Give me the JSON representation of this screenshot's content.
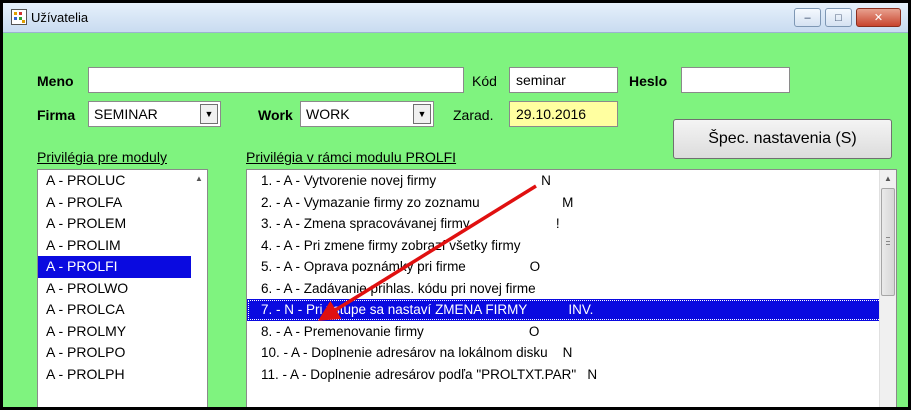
{
  "window": {
    "title": "Užívatelia",
    "minimize_glyph": "–",
    "maximize_glyph": "□",
    "close_glyph": "✕"
  },
  "form": {
    "meno_label": "Meno",
    "meno_value": "",
    "kod_label": "Kód",
    "kod_value": "seminar",
    "heslo_label": "Heslo",
    "heslo_value": "",
    "firma_label": "Firma",
    "firma_value": "SEMINAR",
    "work_label": "Work",
    "work_value": "WORK",
    "zarad_label": "Zarad.",
    "zarad_value": "29.10.2016",
    "spec_button_label": "Špec. nastavenia (S)"
  },
  "modules": {
    "header": "Privilégia pre moduly",
    "items": [
      "A - PROLUC",
      "A - PROLFA",
      "A - PROLEM",
      "A - PROLIM",
      "A - PROLFI",
      "A - PROLWO",
      "A - PROLCA",
      "A - PROLMY",
      "A - PROLPO",
      "A - PROLPH"
    ],
    "selected_index": 4
  },
  "privileges": {
    "header": "Privilégia v rámci modulu  PROLFI",
    "items": [
      "1. - A - Vytvorenie novej firmy                            N",
      "2. - A - Vymazanie firmy zo zoznamu                      M",
      "3. - A - Zmena spracovávanej firmy                       !",
      "4. - A - Pri zmene firmy zobrazí všetky firmy",
      "5. - A - Oprava poznámky pri firme                 O",
      "6. - A - Zadávanie prihlas. kódu pri novej firme",
      "7. - N - Pri vstupe sa nastaví ZMENA FIRMY           INV.",
      "8. - A - Premenovanie firmy                            O",
      "10. - A - Doplnenie adresárov na lokálnom disku    N",
      "11. - A - Doplnenie adresárov podľa \"PROLTXT.PAR\"   N"
    ],
    "selected_index": 6
  },
  "colors": {
    "window_bg": "#7ff37f",
    "selection": "#0a0ae0",
    "date_bg": "#ffffa0",
    "annotation_arrow": "#e01010"
  }
}
